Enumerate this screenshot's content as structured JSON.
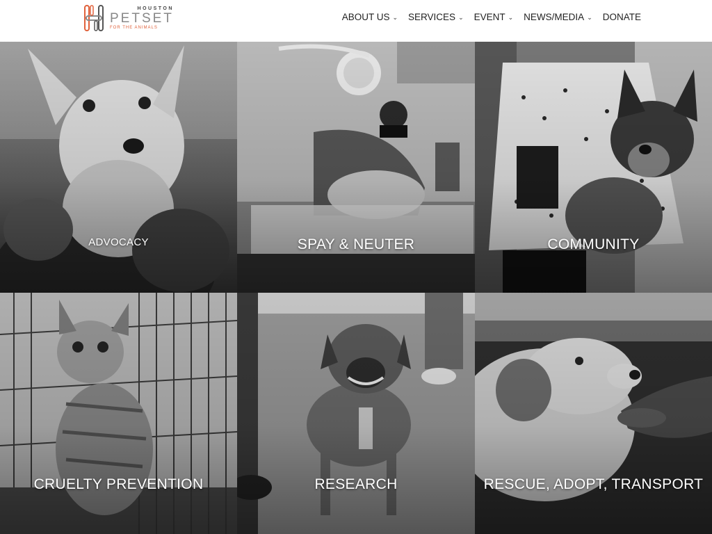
{
  "header": {
    "logo": {
      "top": "HOUSTON",
      "main": "PETSET",
      "tagline": "FOR THE ANIMALS"
    },
    "nav": [
      {
        "label": "ABOUT US",
        "has_dropdown": true
      },
      {
        "label": "SERVICES",
        "has_dropdown": true
      },
      {
        "label": "EVENT",
        "has_dropdown": true
      },
      {
        "label": "NEWS/MEDIA",
        "has_dropdown": true
      },
      {
        "label": "DONATE",
        "has_dropdown": false
      }
    ],
    "chevron": "⌄"
  },
  "tiles": [
    {
      "label": "ADVOCACY",
      "image": "puppy-in-hands-photo"
    },
    {
      "label": "SPAY & NEUTER",
      "image": "vet-surgery-photo"
    },
    {
      "label": "COMMUNITY",
      "image": "german-shepherd-puppy-photo"
    },
    {
      "label": "CRUELTY PREVENTION",
      "image": "kitten-in-cage-photo"
    },
    {
      "label": "RESEARCH",
      "image": "smiling-dog-photo"
    },
    {
      "label": "RESCUE, ADOPT, TRANSPORT",
      "image": "dog-sniffing-hand-photo"
    }
  ],
  "colors": {
    "accent": "#e0613b",
    "text_dark": "#222222",
    "logo_gray": "#888888"
  }
}
